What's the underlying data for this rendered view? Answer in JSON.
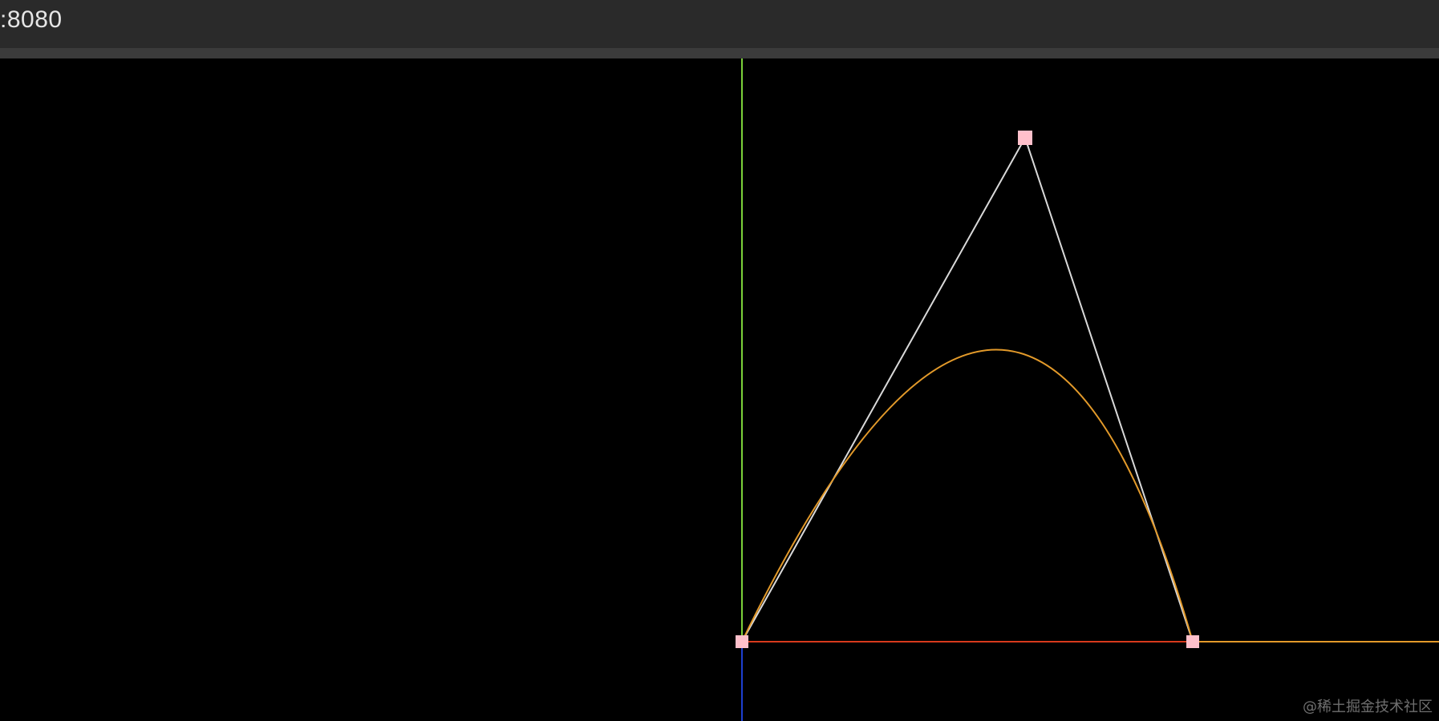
{
  "browser": {
    "address_text": ":8080"
  },
  "scene": {
    "background_color": "#000000",
    "axes": {
      "x_color": "#d83a1c",
      "y_color": "#7bd13a",
      "z_color": "#1d3fd0"
    },
    "control_line_color": "#d9d9d9",
    "curve_color": "#e39a2a",
    "handle_color": "#ffc0cb"
  },
  "watermark": {
    "text": "@稀土掘金技术社区"
  }
}
